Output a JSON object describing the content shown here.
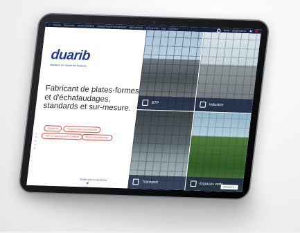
{
  "nav": {
    "items": [
      "DUARIB",
      "PRODUITS",
      "DEVIS EXPRESS",
      "CONCEPTIONS SUR-MESURE",
      "NOS OFFRES",
      "ACTUALITÉS",
      "FAQ",
      "CONTACT"
    ],
    "blog": "BLOG",
    "account": "ACHEVOIR LA"
  },
  "brand": {
    "logo": "duarib",
    "tagline": "Novateur sur toutes les hauteurs"
  },
  "hero": {
    "heading": "Fabricant de plates-formes et d'échafaudages, standards et sur-mesure."
  },
  "buttons": {
    "produits": "PRODUITS",
    "conceptions": "CONCEPTIONS SUR-MESURE",
    "aide": "AIDE AU CHOIX PLATES-FORMES",
    "devis": "DEVIS EXPRESS FREE"
  },
  "scroll_text": "Scroller pour en savoir plus",
  "tiles": [
    {
      "label": "BTP",
      "icon": "helmet-icon"
    },
    {
      "label": "Industrie",
      "icon": "factory-icon"
    },
    {
      "label": "Transport",
      "icon": "truck-icon"
    },
    {
      "label": "Espaces verts",
      "icon": "leaf-icon"
    }
  ],
  "produits_tab": "PRODUITS +",
  "colors": {
    "navy": "#14213d",
    "brand_blue": "#1e3d8f",
    "accent_red": "#e05a4b"
  }
}
